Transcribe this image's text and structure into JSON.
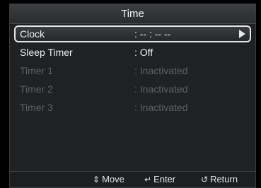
{
  "window": {
    "title": "Time"
  },
  "menu": {
    "items": [
      {
        "label": "Clock",
        "value": ": -- : -- --",
        "state": "selected"
      },
      {
        "label": "Sleep Timer",
        "value": ": Off",
        "state": "enabled"
      },
      {
        "label": "Timer 1",
        "value": ": Inactivated",
        "state": "disabled"
      },
      {
        "label": "Timer 2",
        "value": ": Inactivated",
        "state": "disabled"
      },
      {
        "label": "Timer 3",
        "value": ": Inactivated",
        "state": "disabled"
      }
    ]
  },
  "footer": {
    "move": {
      "icon": "up-down-icon",
      "glyph": "⇕",
      "label": "Move"
    },
    "enter": {
      "icon": "enter-icon",
      "glyph": "↵",
      "label": "Enter"
    },
    "return": {
      "icon": "return-icon",
      "glyph": "↺",
      "label": "Return"
    }
  },
  "colors": {
    "highlight_border": "#e8e8e8",
    "panel": "#1f2123",
    "disabled_text": "#5e6166"
  }
}
